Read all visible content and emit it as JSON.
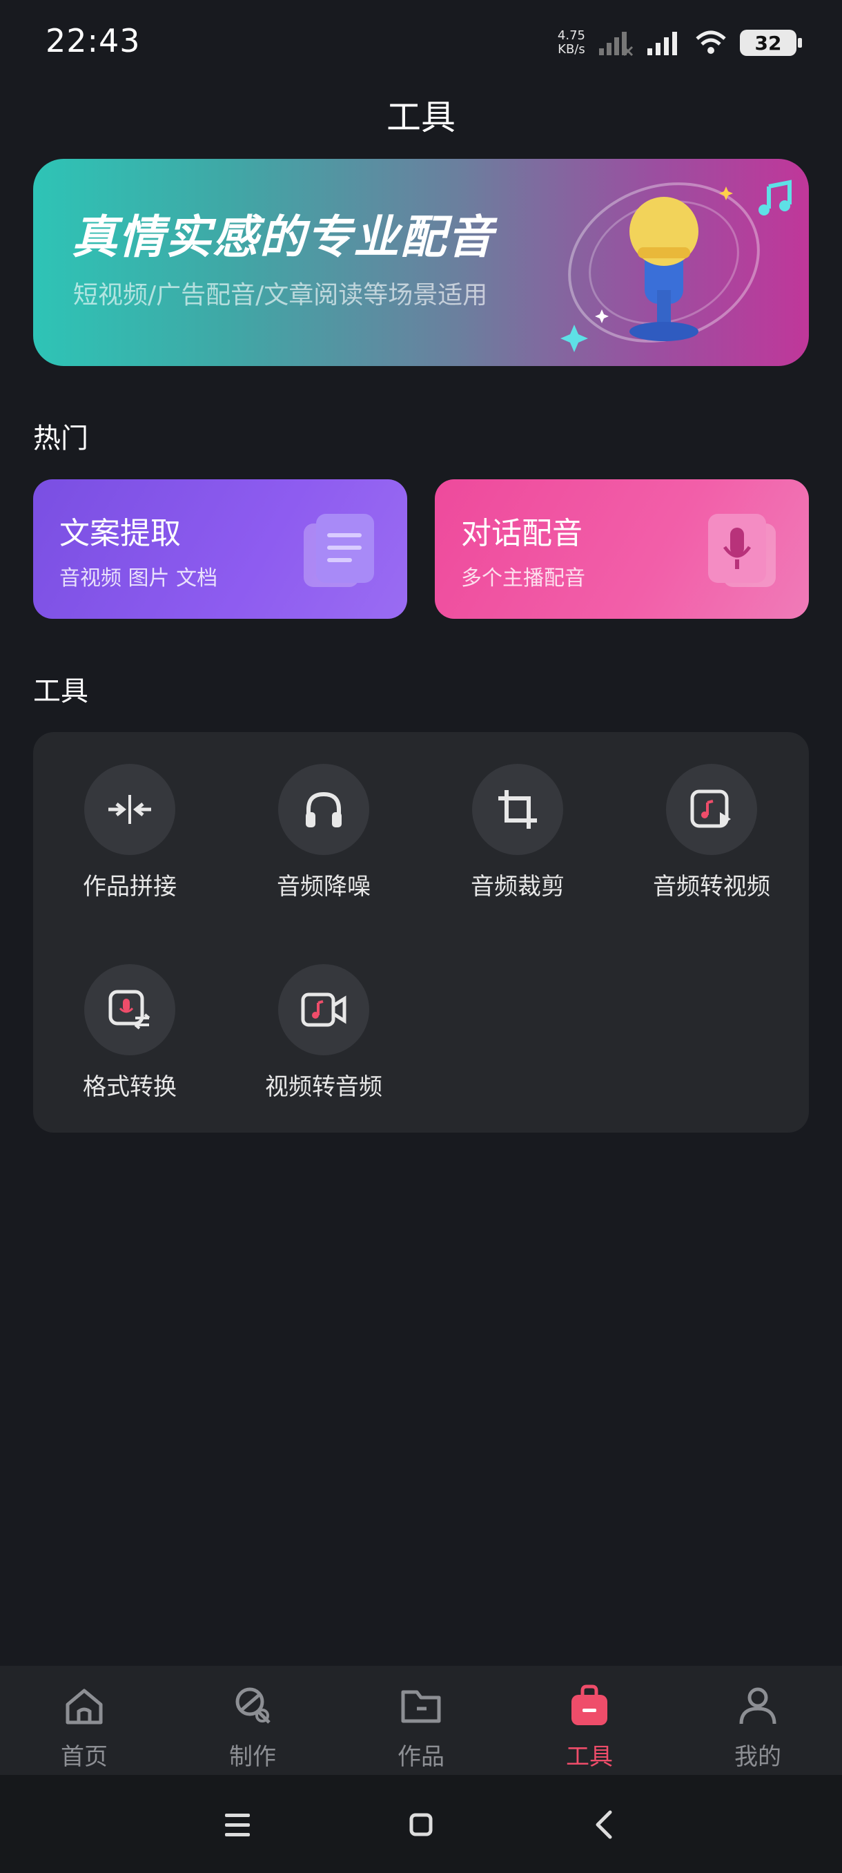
{
  "status_bar": {
    "time": "22:43",
    "net_speed_value": "4.75",
    "net_speed_unit": "KB/s",
    "battery": "32"
  },
  "header": {
    "title": "工具"
  },
  "banner": {
    "title": "真情实感的专业配音",
    "subtitle": "短视频/广告配音/文章阅读等场景适用"
  },
  "hot": {
    "section_label": "热门",
    "cards": [
      {
        "title": "文案提取",
        "subtitle": "音视频 图片 文档",
        "icon": "document-icon",
        "color": "#8a58ee"
      },
      {
        "title": "对话配音",
        "subtitle": "多个主播配音",
        "icon": "microphone-icon",
        "color": "#f055a5"
      }
    ]
  },
  "tools": {
    "section_label": "工具",
    "items": [
      {
        "label": "作品拼接",
        "icon": "merge-icon"
      },
      {
        "label": "音频降噪",
        "icon": "headphones-icon"
      },
      {
        "label": "音频裁剪",
        "icon": "crop-icon"
      },
      {
        "label": "音频转视频",
        "icon": "audio-to-video-icon"
      },
      {
        "label": "格式转换",
        "icon": "format-convert-icon"
      },
      {
        "label": "视频转音频",
        "icon": "video-to-audio-icon"
      }
    ]
  },
  "bottom_nav": {
    "items": [
      {
        "label": "首页",
        "icon": "home-icon"
      },
      {
        "label": "制作",
        "icon": "create-icon"
      },
      {
        "label": "作品",
        "icon": "folder-icon"
      },
      {
        "label": "工具",
        "icon": "toolbox-icon",
        "active": true
      },
      {
        "label": "我的",
        "icon": "profile-icon"
      }
    ],
    "active_color": "#ef4d6a"
  },
  "system_nav": {
    "buttons": [
      "menu-icon",
      "home-square-icon",
      "back-icon"
    ]
  }
}
